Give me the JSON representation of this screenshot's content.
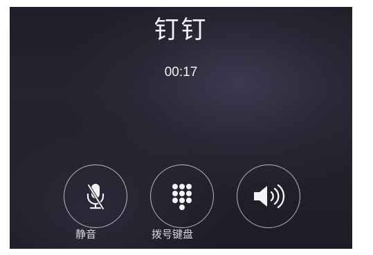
{
  "call": {
    "caller_name": "钉钉",
    "timer": "00:17"
  },
  "controls": [
    {
      "id": "mute",
      "label": "静音",
      "icon": "microphone-muted-icon",
      "active": false
    },
    {
      "id": "keypad",
      "label": "拨号键盘",
      "icon": "keypad-grid-icon",
      "active": false
    },
    {
      "id": "speaker",
      "label": "",
      "icon": "speaker-volume-icon",
      "active": false
    }
  ],
  "colors": {
    "background": "#23212b",
    "text": "#f4f4f6",
    "label": "#d9d9de",
    "ring": "#e6e6ec"
  }
}
